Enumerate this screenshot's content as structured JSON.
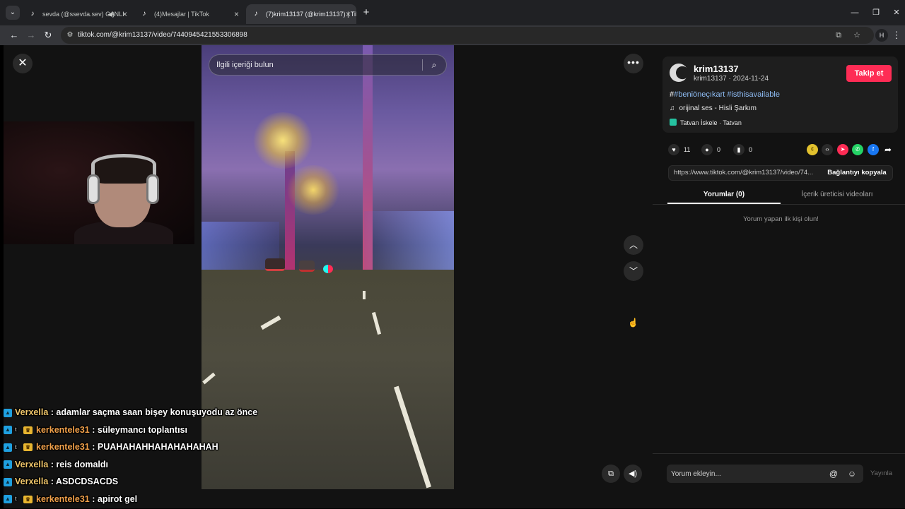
{
  "browser": {
    "tabs": [
      {
        "title": "sevda (@ssevda.sev) CANLI",
        "active": false
      },
      {
        "title": "(4)Mesajlar | TikTok",
        "active": false
      },
      {
        "title": "(7)krim13137 (@krim13137) | TikTok",
        "active": true
      }
    ],
    "url": "tiktok.com/@krim13137/video/7440945421553306898",
    "profile_initial": "H"
  },
  "video_overlay": {
    "search_placeholder": "İlgili içeriği bulun"
  },
  "post": {
    "username": "krim13137",
    "handle": "krim13137",
    "date": "2024-11-24",
    "follow_label": "Takip et",
    "hash_prefix": "#",
    "hashtags": "#beniöneçıkart #isthisavailable",
    "music": "orijinal ses - Hisli Şarkım",
    "location": "Tatvan İskele · Tatvan",
    "likes": "11",
    "comments": "0",
    "saves": "0",
    "link_url": "https://www.tiktok.com/@krim13137/video/74...",
    "copy_label": "Bağlantıyı kopyala",
    "tab_comments": "Yorumlar (0)",
    "tab_creator_videos": "İçerik üreticisi videoları",
    "empty_message": "Yorum yapan ilk kişi olun!",
    "comment_placeholder": "Yorum ekleyin...",
    "post_label": "Yayınla",
    "accent_color": "#fe2c55"
  },
  "chat": [
    {
      "user": "Verxella",
      "message": "adamlar saçma saan bişey konuşuyodu az önce",
      "badges": [
        "prime"
      ]
    },
    {
      "user": "kerkentele31",
      "message": "süleymancı toplantısı",
      "badges": [
        "prime",
        "sub",
        "crown"
      ]
    },
    {
      "user": "kerkentele31",
      "message": "PUAHAHAHHAHAHAHAHAH",
      "badges": [
        "prime",
        "sub",
        "crown"
      ]
    },
    {
      "user": "Verxella",
      "message": "reis domaldı",
      "badges": [
        "prime"
      ]
    },
    {
      "user": "Verxella",
      "message": "ASDCDSACDS",
      "badges": [
        "prime"
      ]
    },
    {
      "user": "kerkentele31",
      "message": "apirot gel",
      "badges": [
        "prime",
        "sub",
        "crown"
      ]
    }
  ]
}
